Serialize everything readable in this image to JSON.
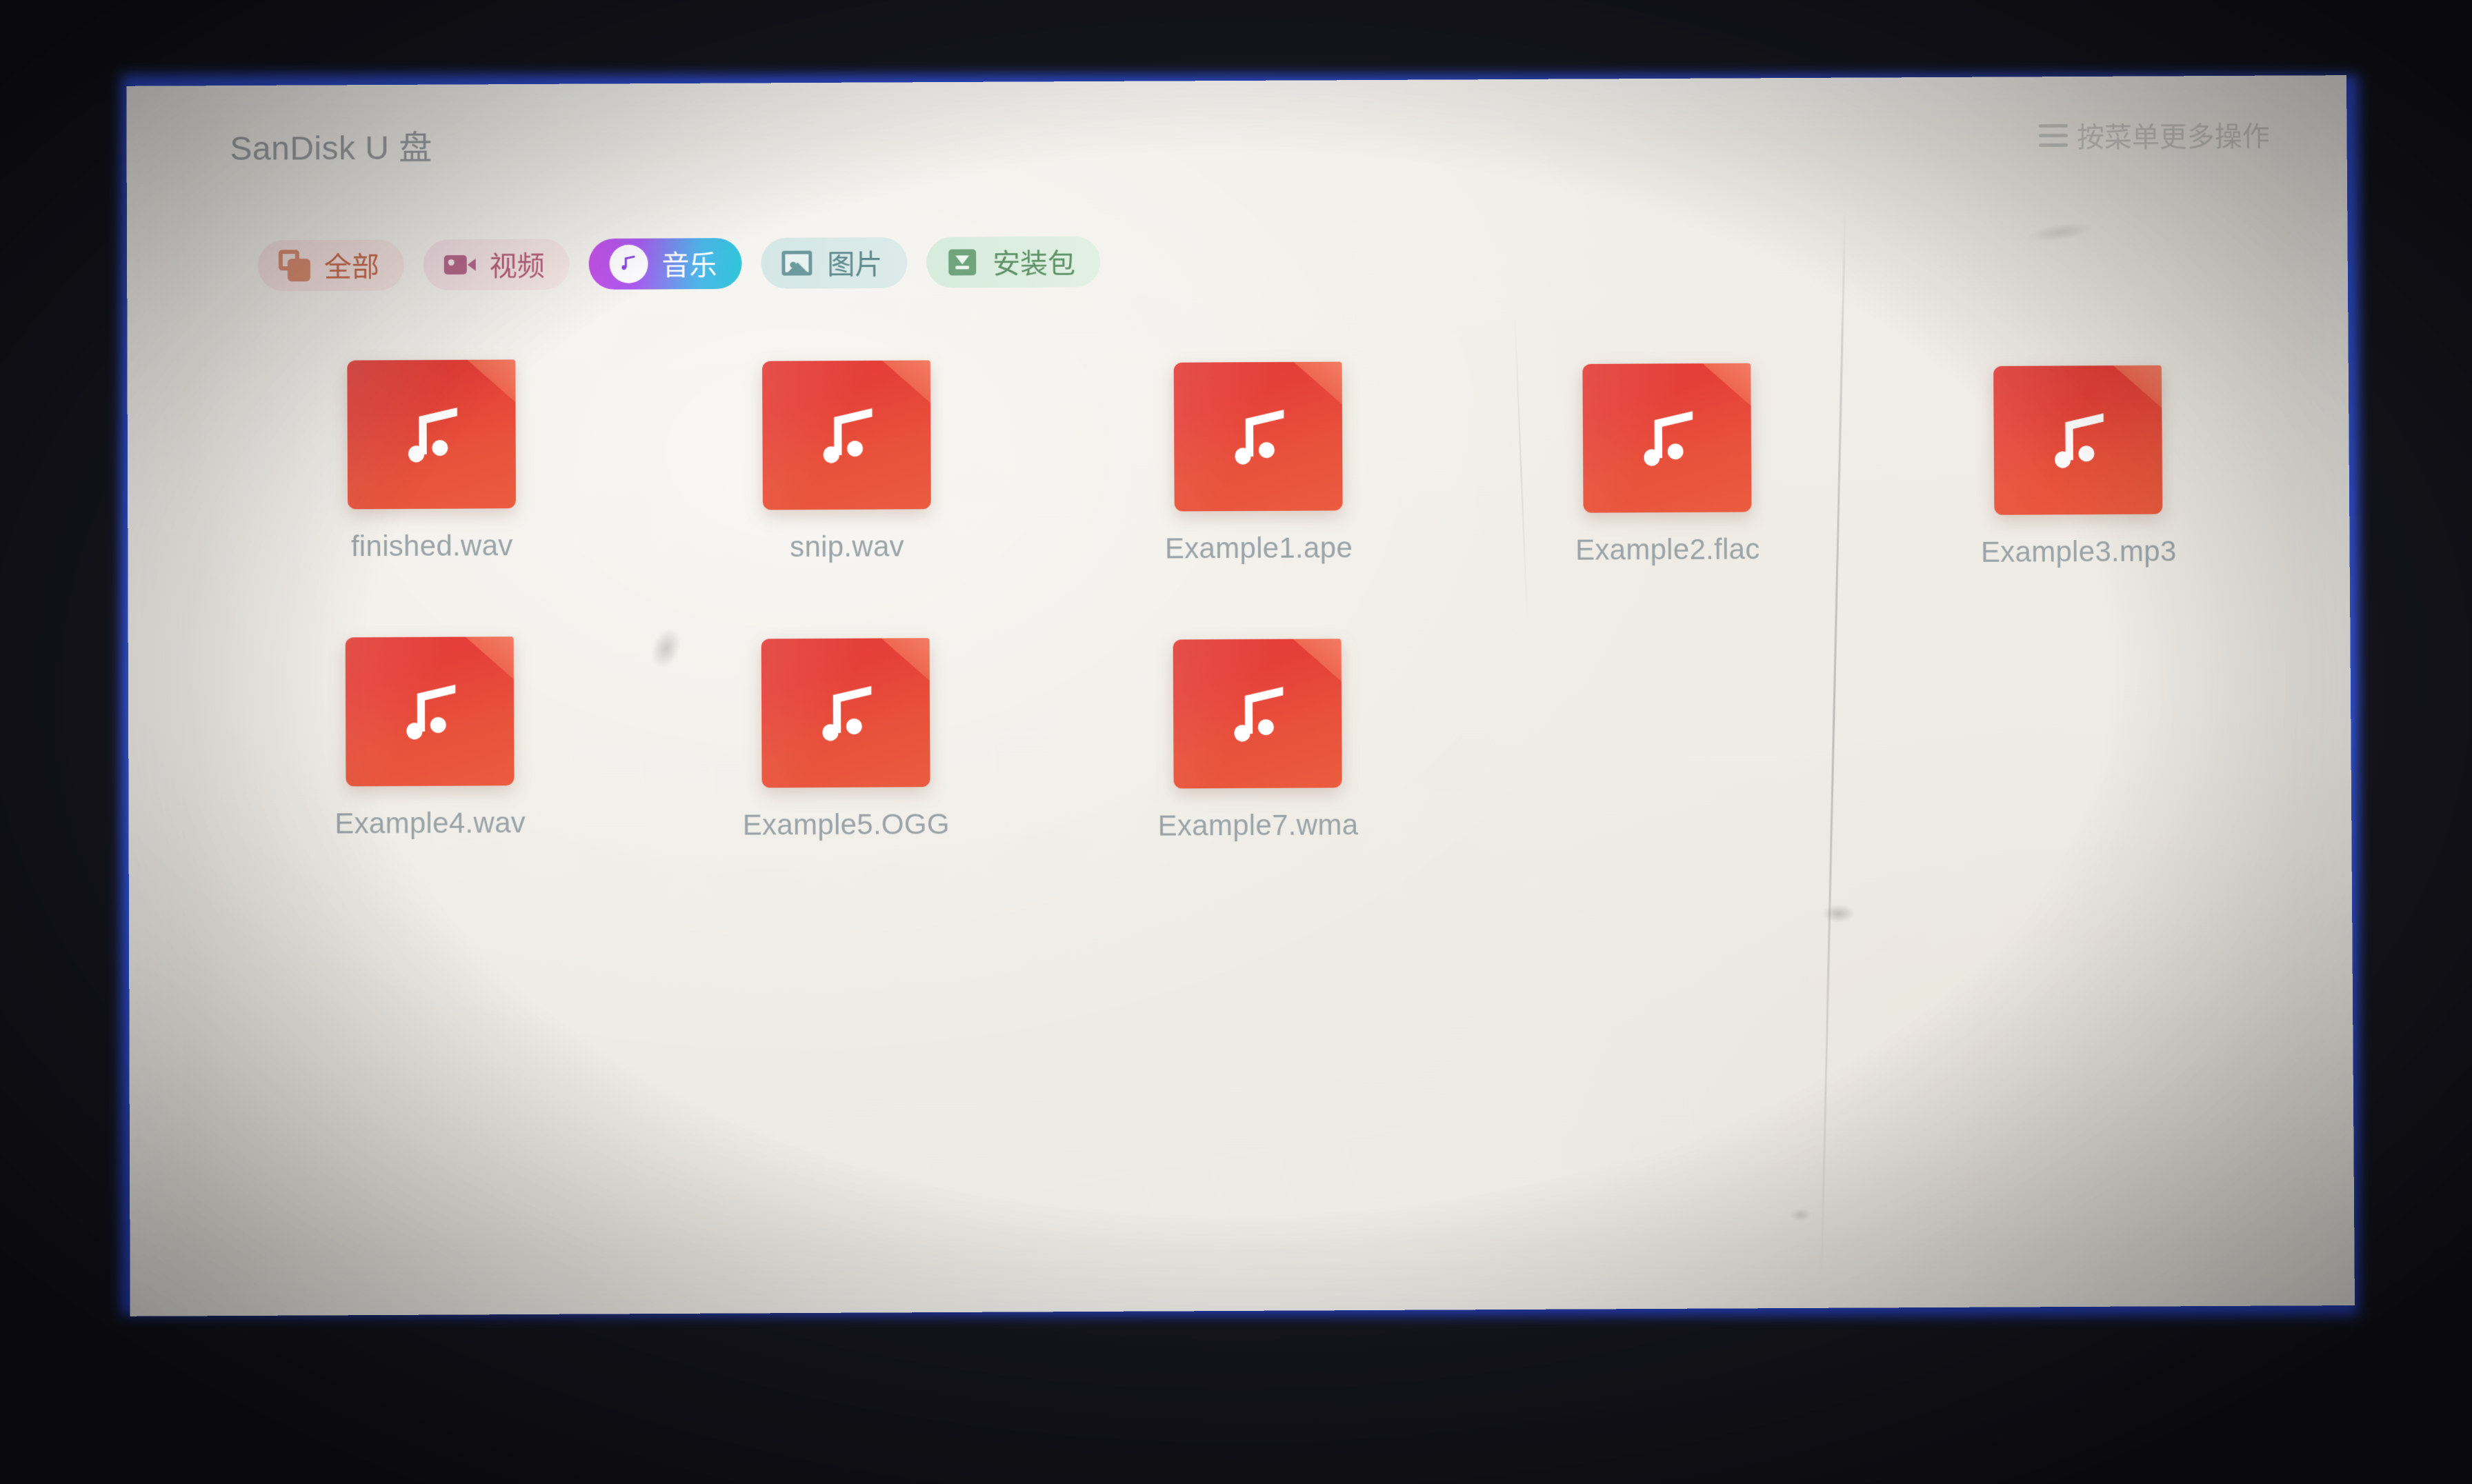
{
  "header": {
    "disk_title": "SanDisk U 盘",
    "menu_hint": "按菜单更多操作",
    "menu_icon": "hamburger-icon"
  },
  "filters": {
    "selected": "音乐",
    "items": [
      {
        "label": "全部",
        "icon": "stacked-squares-icon",
        "accent": "#c86a4e",
        "bg": "#f3dfe0",
        "selected": false
      },
      {
        "label": "视频",
        "icon": "camcorder-icon",
        "accent": "#b85f7d",
        "bg": "#f2e0e6",
        "selected": false
      },
      {
        "label": "音乐",
        "icon": "music-note-icon",
        "accent": "#ffffff",
        "bg": "#a95cf0",
        "selected": true
      },
      {
        "label": "图片",
        "icon": "image-icon",
        "accent": "#5e8a8e",
        "bg": "#d4e7e6",
        "selected": false
      },
      {
        "label": "安装包",
        "icon": "download-box-icon",
        "accent": "#5d9168",
        "bg": "#d7ecdc",
        "selected": false
      }
    ]
  },
  "files": {
    "icon": "music-file-icon",
    "icon_color": "#e5483a",
    "items": [
      {
        "name": "finished.wav"
      },
      {
        "name": "snip.wav"
      },
      {
        "name": "Example1.ape"
      },
      {
        "name": "Example2.flac"
      },
      {
        "name": "Example3.mp3"
      },
      {
        "name": "Example4.wav"
      },
      {
        "name": "Example5.OGG"
      },
      {
        "name": "Example7.wma"
      }
    ]
  },
  "colors": {
    "screen_bg": "#efece5",
    "bezel": "#191921",
    "edge_glow": "#3a63ff",
    "label_text": "#9aa4a8",
    "title_text": "#9ba0a3"
  }
}
